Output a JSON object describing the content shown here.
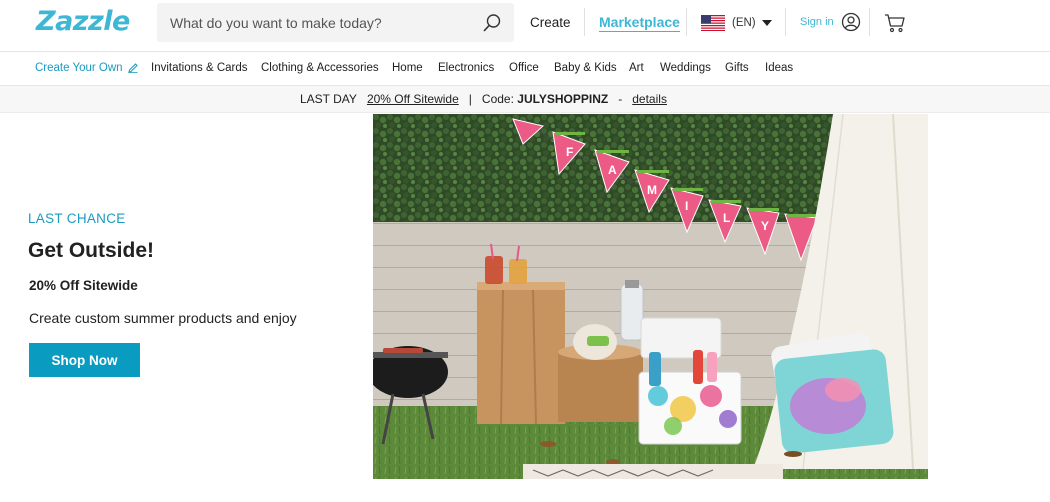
{
  "brand": {
    "logo_text": "Zazzle",
    "accent": "#3db7d4"
  },
  "search": {
    "placeholder": "What do you want to make today?",
    "value": ""
  },
  "header": {
    "create_label": "Create",
    "marketplace_label": "Marketplace",
    "language_label": "(EN)",
    "signin_label": "Sign in"
  },
  "categories": [
    {
      "label": "Create Your Own"
    },
    {
      "label": "Invitations & Cards"
    },
    {
      "label": "Clothing & Accessories"
    },
    {
      "label": "Home"
    },
    {
      "label": "Electronics"
    },
    {
      "label": "Office"
    },
    {
      "label": "Baby & Kids"
    },
    {
      "label": "Art"
    },
    {
      "label": "Weddings"
    },
    {
      "label": "Gifts"
    },
    {
      "label": "Ideas"
    }
  ],
  "promo": {
    "prefix": "LAST DAY",
    "offer": "20% Off Sitewide",
    "sep1": "|",
    "code_label": "Code:",
    "code": "JULYSHOPPINZ",
    "sep2": "-",
    "details_link": "details"
  },
  "hero": {
    "eyebrow": "LAST CHANCE",
    "title": "Get Outside!",
    "subtitle": "20% Off Sitewide",
    "description": "Create custom summer products and enjoy",
    "button_label": "Shop Now",
    "bunting_letters": [
      "F",
      "A",
      "M",
      "I",
      "L",
      "Y"
    ]
  }
}
